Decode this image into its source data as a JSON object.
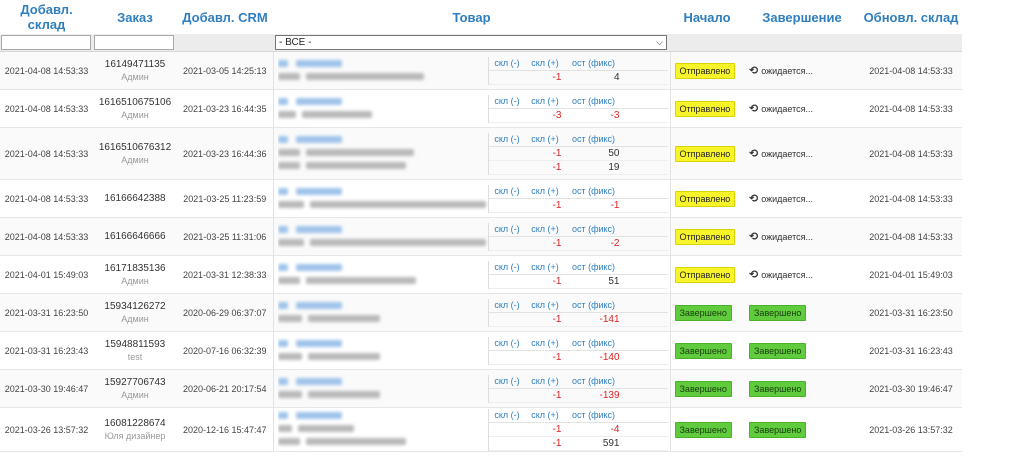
{
  "headers": {
    "added_stock": "Добавл. склад",
    "order": "Заказ",
    "added_crm": "Добавл. CRM",
    "product": "Товар",
    "start": "Начало",
    "finish": "Завершение",
    "updated_stock": "Обновл. склад"
  },
  "filter": {
    "product_select_value": "- ВСЕ -"
  },
  "stock_headers": {
    "minus": "скл (-)",
    "plus": "скл (+)",
    "rest": "ост (фикс)"
  },
  "status_labels": {
    "sent": "Отправлено",
    "done": "Завершено",
    "waiting": "ожидается..."
  },
  "rows": [
    {
      "added": "2021-04-08 14:53:33",
      "order": "16149471135",
      "user": "Админ",
      "crm": "2021-03-05 14:25:13",
      "lines": [
        {
          "m": "",
          "p": "-1",
          "r": "4"
        }
      ],
      "start": "sent",
      "end": "waiting",
      "updated": "2021-04-08 14:53:33"
    },
    {
      "added": "2021-04-08 14:53:33",
      "order": "1616510675106",
      "user": "Админ",
      "crm": "2021-03-23 16:44:35",
      "lines": [
        {
          "m": "",
          "p": "-3",
          "r": "-3"
        }
      ],
      "start": "sent",
      "end": "waiting",
      "updated": "2021-04-08 14:53:33"
    },
    {
      "added": "2021-04-08 14:53:33",
      "order": "1616510676312",
      "user": "Админ",
      "crm": "2021-03-23 16:44:36",
      "lines": [
        {
          "m": "",
          "p": "-1",
          "r": "50"
        },
        {
          "m": "",
          "p": "-1",
          "r": "19"
        }
      ],
      "start": "sent",
      "end": "waiting",
      "updated": "2021-04-08 14:53:33"
    },
    {
      "added": "2021-04-08 14:53:33",
      "order": "16166642388",
      "user": "",
      "crm": "2021-03-25 11:23:59",
      "lines": [
        {
          "m": "",
          "p": "-1",
          "r": "-1"
        }
      ],
      "start": "sent",
      "end": "waiting",
      "updated": "2021-04-08 14:53:33"
    },
    {
      "added": "2021-04-08 14:53:33",
      "order": "16166646666",
      "user": "",
      "crm": "2021-03-25 11:31:06",
      "lines": [
        {
          "m": "",
          "p": "-1",
          "r": "-2"
        }
      ],
      "start": "sent",
      "end": "waiting",
      "updated": "2021-04-08 14:53:33"
    },
    {
      "added": "2021-04-01 15:49:03",
      "order": "16171835136",
      "user": "Админ",
      "crm": "2021-03-31 12:38:33",
      "lines": [
        {
          "m": "",
          "p": "-1",
          "r": "51"
        }
      ],
      "start": "sent",
      "end": "waiting",
      "updated": "2021-04-01 15:49:03"
    },
    {
      "added": "2021-03-31 16:23:50",
      "order": "15934126272",
      "user": "Админ",
      "crm": "2020-06-29 06:37:07",
      "lines": [
        {
          "m": "",
          "p": "-1",
          "r": "-141"
        }
      ],
      "start": "done",
      "end": "done",
      "updated": "2021-03-31 16:23:50"
    },
    {
      "added": "2021-03-31 16:23:43",
      "order": "15948811593",
      "user": "test",
      "crm": "2020-07-16 06:32:39",
      "lines": [
        {
          "m": "",
          "p": "-1",
          "r": "-140"
        }
      ],
      "start": "done",
      "end": "done",
      "updated": "2021-03-31 16:23:43"
    },
    {
      "added": "2021-03-30 19:46:47",
      "order": "15927706743",
      "user": "Админ",
      "crm": "2020-06-21 20:17:54",
      "lines": [
        {
          "m": "",
          "p": "-1",
          "r": "-139"
        }
      ],
      "start": "done",
      "end": "done",
      "updated": "2021-03-30 19:46:47"
    },
    {
      "added": "2021-03-26 13:57:32",
      "order": "16081228674",
      "user": "Юля дизайнер",
      "crm": "2020-12-16 15:47:47",
      "lines": [
        {
          "m": "",
          "p": "-1",
          "r": "-4"
        },
        {
          "m": "",
          "p": "-1",
          "r": "591"
        }
      ],
      "start": "done",
      "end": "done",
      "updated": "2021-03-26 13:57:32"
    }
  ]
}
